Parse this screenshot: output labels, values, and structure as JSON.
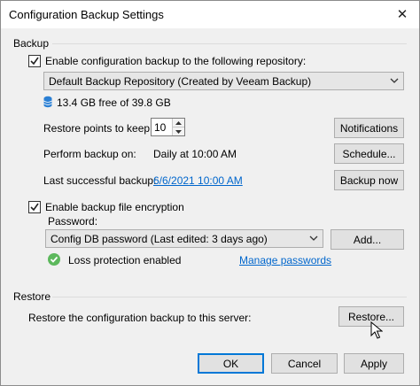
{
  "window": {
    "title": "Configuration Backup Settings",
    "close_glyph": "✕"
  },
  "backup": {
    "section_label": "Backup",
    "enable_backup": {
      "label": "Enable configuration backup to the following repository:",
      "checked": true
    },
    "repository": {
      "selected": "Default Backup Repository (Created by Veeam Backup)"
    },
    "free_space": "13.4 GB free of 39.8 GB",
    "restore_points": {
      "label": "Restore points to keep:",
      "value": "10"
    },
    "notifications_button": "Notifications",
    "perform_backup": {
      "label": "Perform backup on:",
      "value": "Daily at 10:00 AM"
    },
    "schedule_button": "Schedule...",
    "last_backup": {
      "label": "Last successful backup:",
      "value": "6/6/2021 10:00 AM"
    },
    "backup_now_button": "Backup now",
    "encryption": {
      "label": "Enable backup file encryption",
      "checked": true,
      "password_label": "Password:",
      "password_selected": "Config DB password (Last edited: 3 days ago)",
      "add_button": "Add...",
      "loss_protection": "Loss protection enabled",
      "manage_link": "Manage passwords"
    }
  },
  "restore": {
    "section_label": "Restore",
    "description": "Restore the configuration backup to this server:",
    "restore_button": "Restore..."
  },
  "footer": {
    "ok_button": "OK",
    "cancel_button": "Cancel",
    "apply_button": "Apply"
  },
  "colors": {
    "link": "#0066cc",
    "accent_border": "#0078d7",
    "success_green": "#5cb85c",
    "db_icon_blue": "#2a7fd4"
  },
  "icons": [
    "close-icon",
    "checkmark-icon",
    "dropdown-arrow-icon",
    "database-icon",
    "spin-up-icon",
    "spin-down-icon",
    "success-check-icon",
    "mouse-cursor-icon"
  ]
}
